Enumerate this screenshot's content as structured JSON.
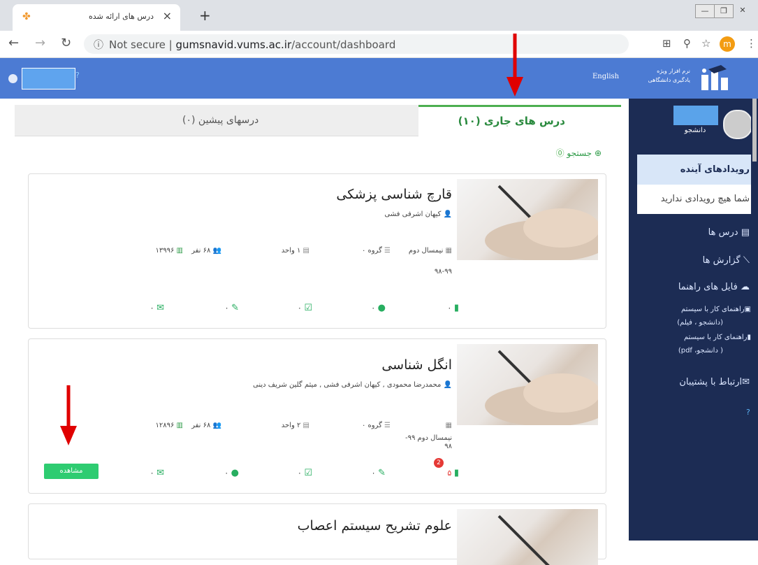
{
  "browser": {
    "tab_title": "درس های ارائه شده",
    "close_label": "×",
    "newtab_label": "+",
    "window_controls": [
      "—",
      "❐",
      "✕"
    ],
    "info_label": "ⓘ",
    "url_prefix": "Not secure  |  ",
    "url_host": "gumsnavid.vums.ac.ir",
    "url_path": "/account/dashboard",
    "profile_letter": "m"
  },
  "header": {
    "english_label": "English",
    "logo_text": "نرم افزار ویژه یادگیری دانشگاهی",
    "help_glyph": "?"
  },
  "sidebar": {
    "role": "دانشجو",
    "events_title": "رویدادهای آینده",
    "events_empty": "شما هیچ رویدادی ندارید",
    "items": [
      {
        "label": "درس ها",
        "icon": "book-icon"
      },
      {
        "label": "گزارش ها",
        "icon": "chart-icon"
      },
      {
        "label": "فایل های راهنما",
        "icon": "download-cloud-icon"
      }
    ],
    "guides": [
      {
        "line1": "راهنمای کار با سیستم",
        "line2": "(دانشجو ، فیلم)"
      },
      {
        "line1": "راهنمای کار با سیستم",
        "line2": "( دانشجو، pdf)"
      }
    ],
    "support_label": "ارتباط با پشتیبان",
    "help_glyph": "?"
  },
  "tabs": {
    "current_label": "درس های جاری (۱۰)",
    "previous_label": "درسهای پیشین (۰)"
  },
  "search_label": "جستجو",
  "courses": [
    {
      "title": "قارچ شناسی پزشکی",
      "teacher": "کیهان اشرفی فشی",
      "semester": "نیمسال دوم",
      "year": "۹۸-۹۹",
      "group": "گروه ۰",
      "units": "۱  واحد",
      "students": "۶۸ نفر",
      "code": "۱۳۹۹۶",
      "stats": [
        "۰",
        "۰",
        "۰",
        "۰",
        "۰"
      ]
    },
    {
      "title": "انگل شناسی",
      "teacher": "محمدرضا محمودی , کیهان اشرفی فشی , میثم گلین شریف دینی",
      "semester": "نیمسال دوم ۹۹-",
      "year": "۹۸",
      "group": "گروه ۰",
      "units": "۲  واحد",
      "students": "۶۸  نفر",
      "code": "۱۲۸۹۶",
      "stats": [
        "۵",
        "۰",
        "۰",
        "۰",
        "۰"
      ],
      "badge": "2",
      "view_label": "مشاهده"
    },
    {
      "title": "علوم تشریح سیستم اعصاب"
    }
  ],
  "colors": {
    "header_blue": "#4c7bd3",
    "sidebar_navy": "#1c2c54",
    "accent_green": "#2ecc71",
    "arrow_red": "#e00000"
  }
}
